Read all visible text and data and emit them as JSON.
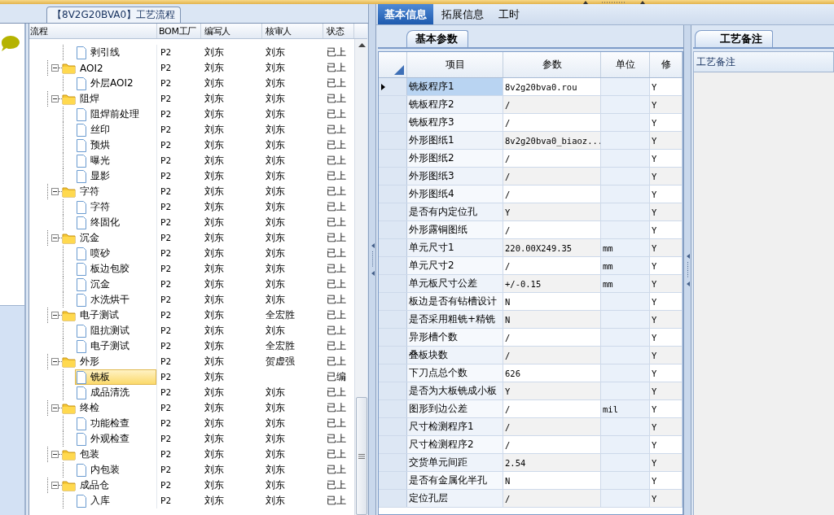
{
  "process_panel": {
    "title": "【8V2G20BVA0】工艺流程",
    "columns": [
      "流程",
      "BOM工厂",
      "编写人",
      "核审人",
      "状态"
    ],
    "tree": [
      {
        "kind": "file",
        "name": "剥引线",
        "bom": "P2",
        "writer": "刘东",
        "reviewer": "刘东",
        "status": "已上",
        "selected": false
      },
      {
        "kind": "folder",
        "name": "AOI2",
        "bom": "P2",
        "writer": "刘东",
        "reviewer": "刘东",
        "status": "已上",
        "selected": false,
        "expanded": true,
        "children": [
          {
            "kind": "file",
            "name": "外层AOI2",
            "bom": "P2",
            "writer": "刘东",
            "reviewer": "刘东",
            "status": "已上",
            "selected": false
          }
        ]
      },
      {
        "kind": "folder",
        "name": "阻焊",
        "bom": "P2",
        "writer": "刘东",
        "reviewer": "刘东",
        "status": "已上",
        "selected": false,
        "expanded": true,
        "children": [
          {
            "kind": "file",
            "name": "阻焊前处理",
            "bom": "P2",
            "writer": "刘东",
            "reviewer": "刘东",
            "status": "已上",
            "selected": false
          },
          {
            "kind": "file",
            "name": "丝印",
            "bom": "P2",
            "writer": "刘东",
            "reviewer": "刘东",
            "status": "已上",
            "selected": false
          },
          {
            "kind": "file",
            "name": "预烘",
            "bom": "P2",
            "writer": "刘东",
            "reviewer": "刘东",
            "status": "已上",
            "selected": false
          },
          {
            "kind": "file",
            "name": "曝光",
            "bom": "P2",
            "writer": "刘东",
            "reviewer": "刘东",
            "status": "已上",
            "selected": false
          },
          {
            "kind": "file",
            "name": "显影",
            "bom": "P2",
            "writer": "刘东",
            "reviewer": "刘东",
            "status": "已上",
            "selected": false
          }
        ]
      },
      {
        "kind": "folder",
        "name": "字符",
        "bom": "P2",
        "writer": "刘东",
        "reviewer": "刘东",
        "status": "已上",
        "selected": false,
        "expanded": true,
        "children": [
          {
            "kind": "file",
            "name": "字符",
            "bom": "P2",
            "writer": "刘东",
            "reviewer": "刘东",
            "status": "已上",
            "selected": false
          },
          {
            "kind": "file",
            "name": "终固化",
            "bom": "P2",
            "writer": "刘东",
            "reviewer": "刘东",
            "status": "已上",
            "selected": false
          }
        ]
      },
      {
        "kind": "folder",
        "name": "沉金",
        "bom": "P2",
        "writer": "刘东",
        "reviewer": "刘东",
        "status": "已上",
        "selected": false,
        "expanded": true,
        "children": [
          {
            "kind": "file",
            "name": "喷砂",
            "bom": "P2",
            "writer": "刘东",
            "reviewer": "刘东",
            "status": "已上",
            "selected": false
          },
          {
            "kind": "file",
            "name": "板边包胶",
            "bom": "P2",
            "writer": "刘东",
            "reviewer": "刘东",
            "status": "已上",
            "selected": false
          },
          {
            "kind": "file",
            "name": "沉金",
            "bom": "P2",
            "writer": "刘东",
            "reviewer": "刘东",
            "status": "已上",
            "selected": false
          },
          {
            "kind": "file",
            "name": "水洗烘干",
            "bom": "P2",
            "writer": "刘东",
            "reviewer": "刘东",
            "status": "已上",
            "selected": false
          }
        ]
      },
      {
        "kind": "folder",
        "name": "电子测试",
        "bom": "P2",
        "writer": "刘东",
        "reviewer": "全宏胜",
        "status": "已上",
        "selected": false,
        "expanded": true,
        "children": [
          {
            "kind": "file",
            "name": "阻抗测试",
            "bom": "P2",
            "writer": "刘东",
            "reviewer": "刘东",
            "status": "已上",
            "selected": false
          },
          {
            "kind": "file",
            "name": "电子测试",
            "bom": "P2",
            "writer": "刘东",
            "reviewer": "全宏胜",
            "status": "已上",
            "selected": false
          }
        ]
      },
      {
        "kind": "folder",
        "name": "外形",
        "bom": "P2",
        "writer": "刘东",
        "reviewer": "贺虚强",
        "status": "已上",
        "selected": false,
        "expanded": true,
        "children": [
          {
            "kind": "file",
            "name": "铣板",
            "bom": "P2",
            "writer": "刘东",
            "status": "已编",
            "selected": true
          },
          {
            "kind": "file",
            "name": "成品清洗",
            "bom": "P2",
            "writer": "刘东",
            "reviewer": "刘东",
            "status": "已上",
            "selected": false
          }
        ]
      },
      {
        "kind": "folder",
        "name": "终检",
        "bom": "P2",
        "writer": "刘东",
        "reviewer": "刘东",
        "status": "已上",
        "selected": false,
        "expanded": true,
        "children": [
          {
            "kind": "file",
            "name": "功能检查",
            "bom": "P2",
            "writer": "刘东",
            "reviewer": "刘东",
            "status": "已上",
            "selected": false
          },
          {
            "kind": "file",
            "name": "外观检查",
            "bom": "P2",
            "writer": "刘东",
            "reviewer": "刘东",
            "status": "已上",
            "selected": false
          }
        ]
      },
      {
        "kind": "folder",
        "name": "包装",
        "bom": "P2",
        "writer": "刘东",
        "reviewer": "刘东",
        "status": "已上",
        "selected": false,
        "expanded": true,
        "children": [
          {
            "kind": "file",
            "name": "内包装",
            "bom": "P2",
            "writer": "刘东",
            "reviewer": "刘东",
            "status": "已上",
            "selected": false
          }
        ]
      },
      {
        "kind": "folder",
        "name": "成品仓",
        "bom": "P2",
        "writer": "刘东",
        "reviewer": "刘东",
        "status": "已上",
        "selected": false,
        "expanded": true,
        "children": [
          {
            "kind": "file",
            "name": "入库",
            "bom": "P2",
            "writer": "刘东",
            "reviewer": "刘东",
            "status": "已上",
            "selected": false
          }
        ]
      }
    ]
  },
  "tabs": [
    {
      "label": "基本信息",
      "selected": true
    },
    {
      "label": "拓展信息",
      "selected": false
    },
    {
      "label": "工时",
      "selected": false
    }
  ],
  "params": {
    "tab": "基本参数",
    "columns": [
      "项目",
      "参数",
      "单位",
      "修"
    ],
    "rows": [
      {
        "item": "铣板程序1",
        "value": "8v2g20bva0.rou",
        "modified": "Y",
        "selected": true
      },
      {
        "item": "铣板程序2",
        "value": "/",
        "modified": "Y",
        "selected": false
      },
      {
        "item": "铣板程序3",
        "value": "/",
        "modified": "Y",
        "selected": false
      },
      {
        "item": "外形图纸1",
        "value": "8v2g20bva0_biaoz...",
        "modified": "Y",
        "selected": false
      },
      {
        "item": "外形图纸2",
        "value": "/",
        "modified": "Y",
        "selected": false
      },
      {
        "item": "外形图纸3",
        "value": "/",
        "modified": "Y",
        "selected": false
      },
      {
        "item": "外形图纸4",
        "value": "/",
        "modified": "Y",
        "selected": false
      },
      {
        "item": "是否有内定位孔",
        "value": "Y",
        "modified": "Y",
        "selected": false
      },
      {
        "item": "外形露铜图纸",
        "value": "/",
        "modified": "Y",
        "selected": false
      },
      {
        "item": "单元尺寸1",
        "value": "220.00X249.35",
        "unit": "mm",
        "modified": "Y",
        "selected": false
      },
      {
        "item": "单元尺寸2",
        "value": "/",
        "unit": "mm",
        "modified": "Y",
        "selected": false
      },
      {
        "item": "单元板尺寸公差",
        "value": "+/-0.15",
        "unit": "mm",
        "modified": "Y",
        "selected": false
      },
      {
        "item": "板边是否有钻槽设计",
        "value": "N",
        "modified": "Y",
        "selected": false
      },
      {
        "item": "是否采用粗铣+精铣",
        "value": "N",
        "modified": "Y",
        "selected": false
      },
      {
        "item": "异形槽个数",
        "value": "/",
        "modified": "Y",
        "selected": false
      },
      {
        "item": "叠板块数",
        "value": "/",
        "modified": "Y",
        "selected": false
      },
      {
        "item": "下刀点总个数",
        "value": "626",
        "modified": "Y",
        "selected": false
      },
      {
        "item": "是否为大板铣成小板",
        "value": "Y",
        "modified": "Y",
        "selected": false
      },
      {
        "item": "图形到边公差",
        "value": "/",
        "unit": "mil",
        "modified": "Y",
        "selected": false
      },
      {
        "item": "尺寸检测程序1",
        "value": "/",
        "modified": "Y",
        "selected": false
      },
      {
        "item": "尺寸检测程序2",
        "value": "/",
        "modified": "Y",
        "selected": false
      },
      {
        "item": "交货单元间距",
        "value": "2.54",
        "modified": "Y",
        "selected": false
      },
      {
        "item": "是否有金属化半孔",
        "value": "N",
        "modified": "Y",
        "selected": false
      },
      {
        "item": "定位孔层",
        "value": "/",
        "modified": "Y",
        "selected": false
      }
    ]
  },
  "notes": {
    "tab": "工艺备注",
    "header": "工艺备注"
  }
}
